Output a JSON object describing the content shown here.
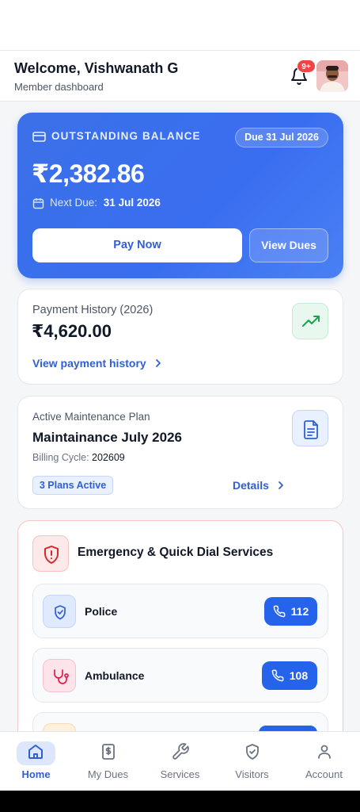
{
  "header": {
    "welcome": "Welcome, Vishwanath G",
    "subtitle": "Member dashboard",
    "notification_count": "9+"
  },
  "balance": {
    "label": "OUTSTANDING BALANCE",
    "due_pill": "Due 31 Jul 2026",
    "amount": "₹2,382.86",
    "next_due_label": "Next Due:",
    "next_due_value": "31 Jul 2026",
    "pay_label": "Pay Now",
    "view_dues_label": "View Dues"
  },
  "payment_history": {
    "title": "Payment History (2026)",
    "amount": "₹4,620.00",
    "link": "View payment history"
  },
  "maintenance": {
    "label": "Active Maintenance Plan",
    "title": "Maintainance July 2026",
    "billing_cycle_label": "Billing Cycle:",
    "billing_cycle_value": "202609",
    "plans_active": "3 Plans Active",
    "details": "Details"
  },
  "emergency": {
    "title": "Emergency & Quick Dial Services",
    "services": [
      {
        "name": "Police",
        "number": "112"
      },
      {
        "name": "Ambulance",
        "number": "108"
      }
    ]
  },
  "nav": {
    "items": [
      {
        "label": "Home",
        "icon": "home-icon",
        "active": true
      },
      {
        "label": "My Dues",
        "icon": "receipt-icon",
        "active": false
      },
      {
        "label": "Services",
        "icon": "wrench-icon",
        "active": false
      },
      {
        "label": "Visitors",
        "icon": "shield-icon",
        "active": false
      },
      {
        "label": "Account",
        "icon": "user-icon",
        "active": false
      }
    ]
  },
  "colors": {
    "accent": "#2563eb",
    "balance_card": "#3b70e8",
    "alert": "#ef4444"
  }
}
